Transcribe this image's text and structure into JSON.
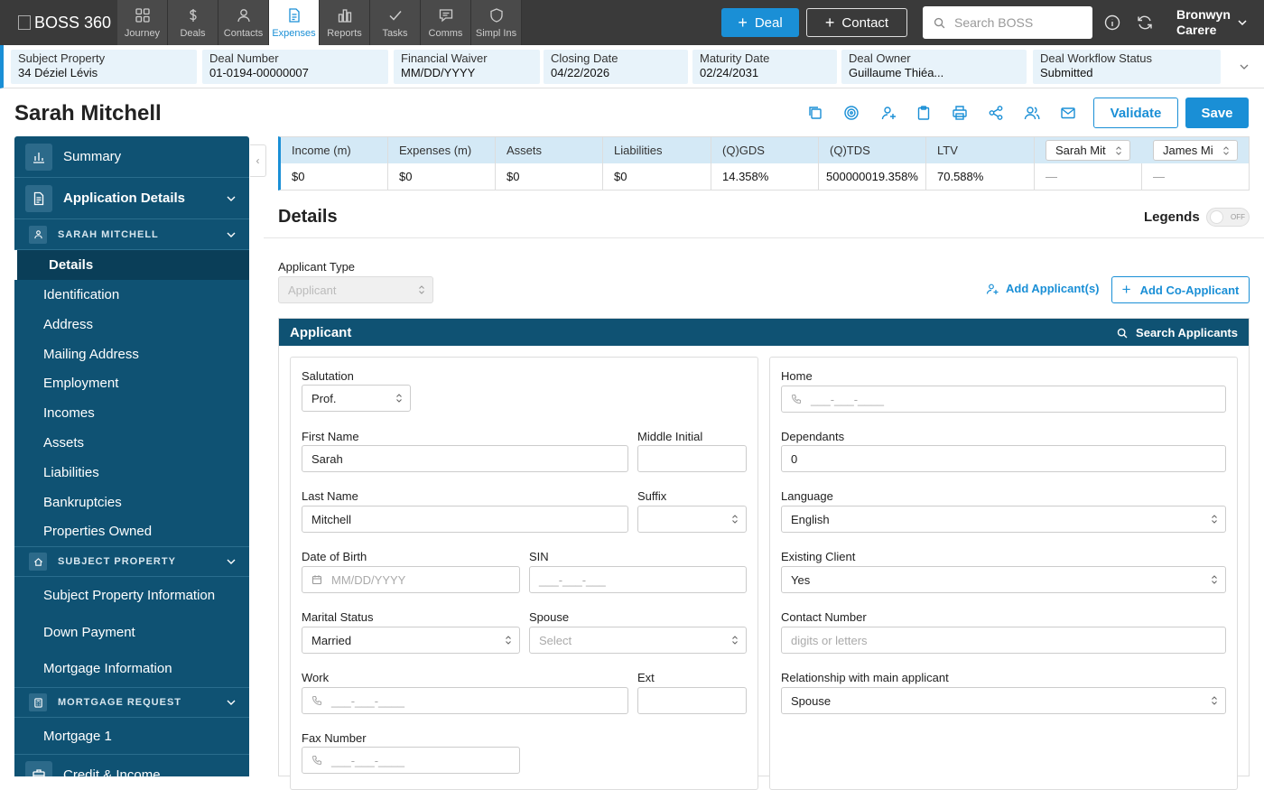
{
  "app": {
    "logo_text": "BOSS 360"
  },
  "nav": {
    "tabs": [
      {
        "label": "Journey",
        "icon": "grid-icon"
      },
      {
        "label": "Deals",
        "icon": "dollar-icon"
      },
      {
        "label": "Contacts",
        "icon": "person-icon"
      },
      {
        "label": "Expenses",
        "icon": "document-icon"
      },
      {
        "label": "Reports",
        "icon": "bar-chart-icon"
      },
      {
        "label": "Tasks",
        "icon": "check-icon"
      },
      {
        "label": "Comms",
        "icon": "chat-icon"
      },
      {
        "label": "Simpl Ins",
        "icon": "shield-icon"
      }
    ],
    "active_tab": "Expenses",
    "deal_button": "Deal",
    "contact_button": "Contact",
    "search_placeholder": "Search BOSS",
    "user_first": "Bronwyn",
    "user_last": "Carere"
  },
  "infobar": {
    "subject_property": {
      "label": "Subject Property",
      "value": "34 Déziel Lévis"
    },
    "deal_number": {
      "label": "Deal Number",
      "value": "01-0194-00000007"
    },
    "financial_waiver": {
      "label": "Financial Waiver",
      "value": "MM/DD/YYYY"
    },
    "closing_date": {
      "label": "Closing Date",
      "value": "04/22/2026"
    },
    "maturity_date": {
      "label": "Maturity Date",
      "value": "02/24/2031"
    },
    "deal_owner": {
      "label": "Deal Owner",
      "value": "Guillaume Thiéa..."
    },
    "workflow_status": {
      "label": "Deal Workflow Status",
      "value": "Submitted"
    }
  },
  "page": {
    "title": "Sarah Mitchell",
    "validate_button": "Validate",
    "save_button": "Save"
  },
  "sidebar": {
    "summary": "Summary",
    "application_details": "Application Details",
    "applicant_section": "SARAH MITCHELL",
    "applicant_items": [
      "Details",
      "Identification",
      "Address",
      "Mailing Address",
      "Employment",
      "Incomes",
      "Assets",
      "Liabilities",
      "Bankruptcies",
      "Properties Owned"
    ],
    "active_item": "Details",
    "subject_property_section": "SUBJECT PROPERTY",
    "subject_property_items": [
      "Subject Property Information",
      "Down Payment",
      "Mortgage Information"
    ],
    "mortgage_request_section": "MORTGAGE REQUEST",
    "mortgage_request_items": [
      "Mortgage 1"
    ],
    "credit_income": "Credit & Income"
  },
  "summary_table": {
    "headers": [
      "Income (m)",
      "Expenses (m)",
      "Assets",
      "Liabilities",
      "(Q)GDS",
      "(Q)TDS",
      "LTV"
    ],
    "values": [
      "$0",
      "$0",
      "$0",
      "$0",
      "14.358%",
      "500000019.358%",
      "70.588%"
    ],
    "applicant_selects": [
      "Sarah Mit",
      "James Mi"
    ],
    "applicant_values": [
      "—",
      "—"
    ]
  },
  "details": {
    "heading": "Details",
    "legends_label": "Legends",
    "legends_toggle": "OFF",
    "applicant_type_label": "Applicant Type",
    "applicant_type_value": "Applicant",
    "add_applicants": "Add Applicant(s)",
    "add_co_applicant": "Add Co-Applicant"
  },
  "applicant_panel": {
    "title": "Applicant",
    "search_applicants": "Search Applicants",
    "left": {
      "salutation": {
        "label": "Salutation",
        "value": "Prof."
      },
      "first_name": {
        "label": "First Name",
        "value": "Sarah"
      },
      "middle_initial": {
        "label": "Middle Initial",
        "value": ""
      },
      "last_name": {
        "label": "Last Name",
        "value": "Mitchell"
      },
      "suffix": {
        "label": "Suffix",
        "value": ""
      },
      "dob": {
        "label": "Date of Birth",
        "placeholder": "MM/DD/YYYY"
      },
      "sin": {
        "label": "SIN",
        "placeholder": "___-___-___"
      },
      "marital_status": {
        "label": "Marital Status",
        "value": "Married"
      },
      "spouse": {
        "label": "Spouse",
        "placeholder": "Select"
      },
      "work": {
        "label": "Work",
        "placeholder": "___-___-____"
      },
      "ext": {
        "label": "Ext",
        "value": ""
      },
      "fax": {
        "label": "Fax Number",
        "placeholder": "___-___-____"
      }
    },
    "right": {
      "home": {
        "label": "Home",
        "placeholder": "___-___-____"
      },
      "dependants": {
        "label": "Dependants",
        "value": "0"
      },
      "language": {
        "label": "Language",
        "value": "English"
      },
      "existing_client": {
        "label": "Existing Client",
        "value": "Yes"
      },
      "contact_number": {
        "label": "Contact Number",
        "placeholder": "digits or letters"
      },
      "relationship": {
        "label": "Relationship with main applicant",
        "value": "Spouse"
      }
    }
  }
}
